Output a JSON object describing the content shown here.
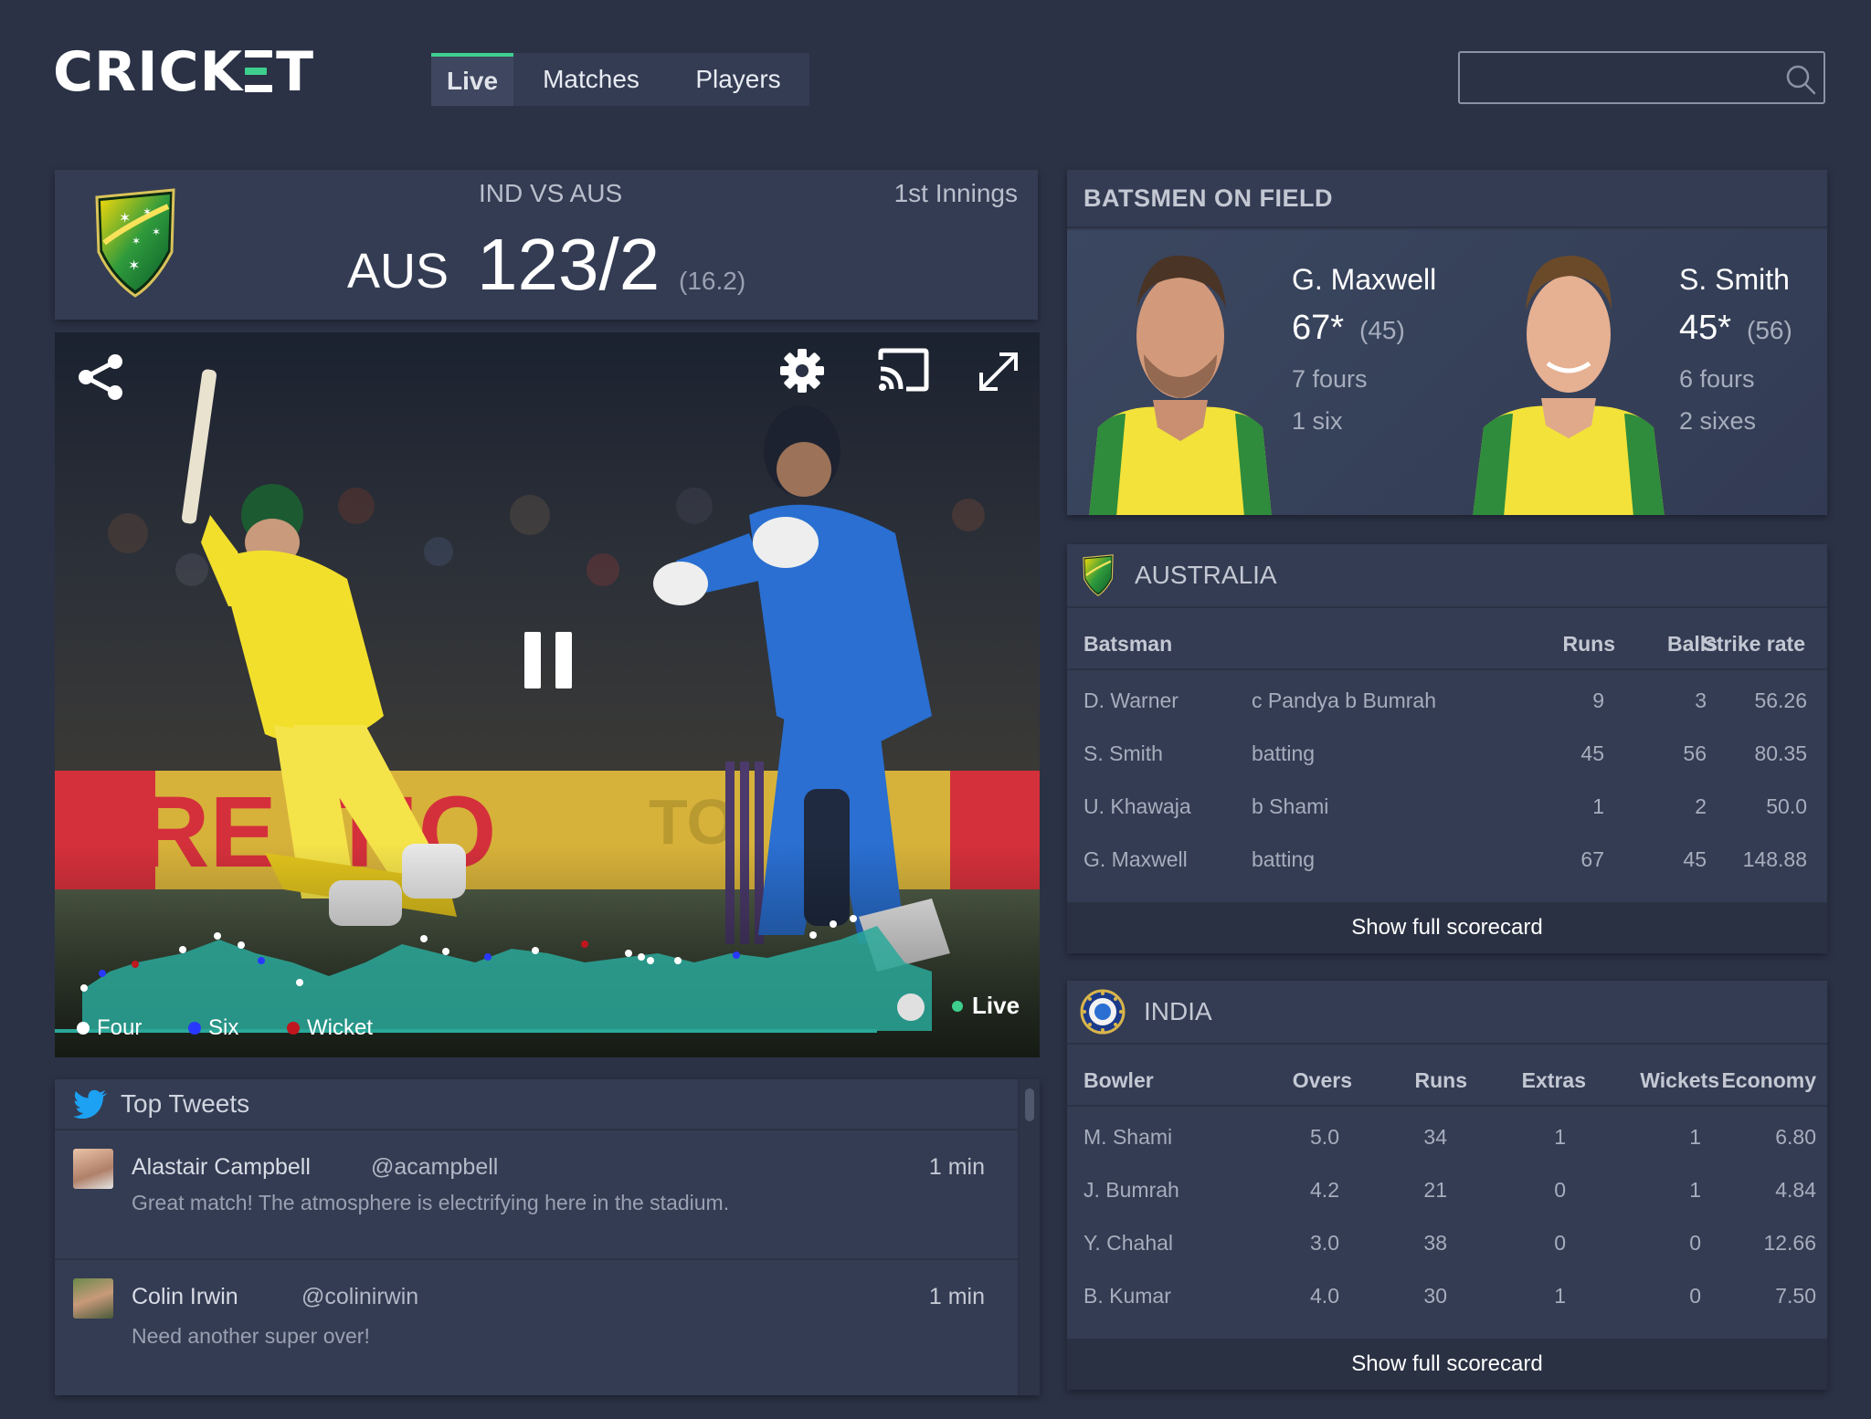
{
  "header": {
    "logo": "CRICKET",
    "tabs": [
      {
        "label": "Live",
        "active": true
      },
      {
        "label": "Matches",
        "active": false
      },
      {
        "label": "Players",
        "active": false
      }
    ],
    "search": {
      "placeholder": "",
      "value": ""
    }
  },
  "score": {
    "match": "IND VS AUS",
    "innings": "1st Innings",
    "team": "AUS",
    "runs_wickets": "123/2",
    "overs": "(16.2)"
  },
  "video": {
    "state": "playing",
    "legend": [
      {
        "label": "Four",
        "color": "#ffffff"
      },
      {
        "label": "Six",
        "color": "#2838ff"
      },
      {
        "label": "Wicket",
        "color": "#c0161e"
      }
    ],
    "live_label": "Live"
  },
  "tweets": {
    "title": "Top Tweets",
    "items": [
      {
        "name": "Alastair Campbell",
        "handle": "@acampbell",
        "time": "1 min",
        "message": "Great match! The atmosphere is electrifying here in the stadium."
      },
      {
        "name": "Colin Irwin",
        "handle": "@colinirwin",
        "time": "1 min",
        "message": "Need another super over!"
      }
    ]
  },
  "batsmen_on_field": {
    "title": "BATSMEN ON FIELD",
    "players": [
      {
        "name": "G. Maxwell",
        "score": "67*",
        "balls": "(45)",
        "fours": "7 fours",
        "sixes": "1 six"
      },
      {
        "name": "S. Smith",
        "score": "45*",
        "balls": "(56)",
        "fours": "6 fours",
        "sixes": "2 sixes"
      }
    ]
  },
  "australia": {
    "name": "AUSTRALIA",
    "columns": [
      "Batsman",
      "Runs",
      "Balls",
      "Strike rate"
    ],
    "rows": [
      {
        "batsman": "D. Warner",
        "dismissal": "c Pandya b Bumrah",
        "runs": "9",
        "balls": "3",
        "sr": "56.26"
      },
      {
        "batsman": "S. Smith",
        "dismissal": "batting",
        "runs": "45",
        "balls": "56",
        "sr": "80.35"
      },
      {
        "batsman": "U. Khawaja",
        "dismissal": "b Shami",
        "runs": "1",
        "balls": "2",
        "sr": "50.0"
      },
      {
        "batsman": "G. Maxwell",
        "dismissal": "batting",
        "runs": "67",
        "balls": "45",
        "sr": "148.88"
      }
    ],
    "show_full": "Show full scorecard"
  },
  "india": {
    "name": "INDIA",
    "columns": [
      "Bowler",
      "Overs",
      "Runs",
      "Extras",
      "Wickets",
      "Economy"
    ],
    "rows": [
      {
        "bowler": "M. Shami",
        "overs": "5.0",
        "runs": "34",
        "extras": "1",
        "wickets": "1",
        "economy": "6.80"
      },
      {
        "bowler": "J. Bumrah",
        "overs": "4.2",
        "runs": "21",
        "extras": "0",
        "wickets": "1",
        "economy": "4.84"
      },
      {
        "bowler": "Y. Chahal",
        "overs": "3.0",
        "runs": "38",
        "extras": "0",
        "wickets": "0",
        "economy": "12.66"
      },
      {
        "bowler": "B. Kumar",
        "overs": "4.0",
        "runs": "30",
        "extras": "1",
        "wickets": "0",
        "economy": "7.50"
      }
    ],
    "show_full": "Show full scorecard"
  }
}
